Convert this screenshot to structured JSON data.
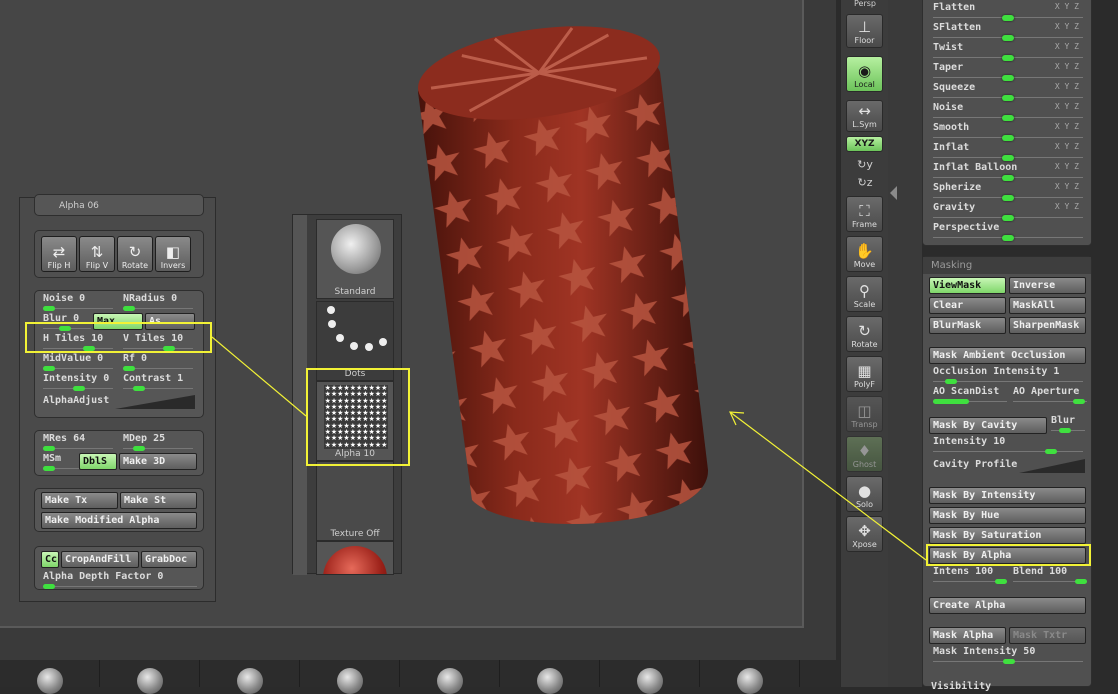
{
  "right_palette": {
    "deformation_rows": [
      {
        "label": "Flatten",
        "axes": "X Y Z",
        "knob": 0.5
      },
      {
        "label": "SFlatten",
        "axes": "X Y Z",
        "knob": 0.5
      },
      {
        "label": "Twist",
        "axes": "X Y Z",
        "knob": 0.5
      },
      {
        "label": "Taper",
        "axes": "X Y Z",
        "knob": 0.5
      },
      {
        "label": "Squeeze",
        "axes": "X Y Z",
        "knob": 0.5
      },
      {
        "label": "Noise",
        "axes": "X Y Z",
        "knob": 0.5
      },
      {
        "label": "Smooth",
        "axes": "X Y Z",
        "knob": 0.5
      },
      {
        "label": "Inflat",
        "axes": "X Y Z",
        "knob": 0.5
      },
      {
        "label": "Inflat Balloon",
        "axes": "X Y Z",
        "knob": 0.5
      },
      {
        "label": "Spherize",
        "axes": "X Y Z",
        "knob": 0.5
      },
      {
        "label": "Gravity",
        "axes": "X Y Z",
        "knob": 0.5
      },
      {
        "label": "Perspective",
        "axes": "",
        "knob": 0.5
      }
    ],
    "masking": {
      "title": "Masking",
      "viewmask": "ViewMask",
      "inverse": "Inverse",
      "clear": "Clear",
      "maskall": "MaskAll",
      "blurmask": "BlurMask",
      "sharpenmask": "SharpenMask",
      "mask_ao": "Mask Ambient Occlusion",
      "occlusion_intensity": "Occlusion Intensity 1",
      "ao_scandist": "AO ScanDist",
      "ao_aperture": "AO Aperture",
      "mask_by_cavity": "Mask By Cavity",
      "blur": "Blur",
      "intensity": "Intensity 10",
      "cavity_profile": "Cavity Profile",
      "mask_by_intensity": "Mask By Intensity",
      "mask_by_hue": "Mask By Hue",
      "mask_by_saturation": "Mask By Saturation",
      "mask_by_alpha": "Mask By Alpha",
      "intens": "Intens 100",
      "blend": "Blend 100",
      "create_alpha": "Create Alpha",
      "mask_alpha": "Mask Alpha",
      "mask_txtr": "Mask Txtr",
      "mask_intensity": "Mask Intensity 50",
      "visibility": "Visibility"
    }
  },
  "shelf": {
    "persp": "Persp",
    "floor": "Floor",
    "local": "Local",
    "lsym": "L.Sym",
    "xyz": "XYZ",
    "frame": "Frame",
    "move": "Move",
    "scale": "Scale",
    "rotate": "Rotate",
    "polyf": "PolyF",
    "transp": "Transp",
    "ghost": "Ghost",
    "solo": "Solo",
    "xpose": "Xpose"
  },
  "left_panel": {
    "alpha_name": "Alpha 06",
    "flip_h": "Flip H",
    "flip_v": "Flip V",
    "rotate": "Rotate",
    "invers": "Invers",
    "noise": "Noise 0",
    "nradius": "NRadius 0",
    "blur": "Blur 0",
    "max": "Max",
    "as": "As",
    "h_tiles": "H Tiles 10",
    "v_tiles": "V Tiles 10",
    "midvalue": "MidValue 0",
    "rf": "Rf 0",
    "intensity": "Intensity 0",
    "contrast": "Contrast 1",
    "alphaadjust": "AlphaAdjust",
    "mres": "MRes 64",
    "mdep": "MDep 25",
    "msm": "MSm",
    "dbls": "DblS",
    "make3d": "Make 3D",
    "make_tx": "Make Tx",
    "make_st": "Make St",
    "make_modified_alpha": "Make Modified Alpha",
    "cc": "Cc",
    "cropandfill": "CropAndFill",
    "grabdoc": "GrabDoc",
    "alpha_depth_factor": "Alpha Depth Factor 0"
  },
  "alpha_strip": {
    "standard": "Standard",
    "dots": "Dots",
    "alpha10": "Alpha 10",
    "texture_off": "Texture Off"
  },
  "colors": {
    "slider_green": "#3fe03f",
    "highlight": "#f2f236",
    "cylinder": "#7a2418",
    "star": "#b7543f"
  }
}
